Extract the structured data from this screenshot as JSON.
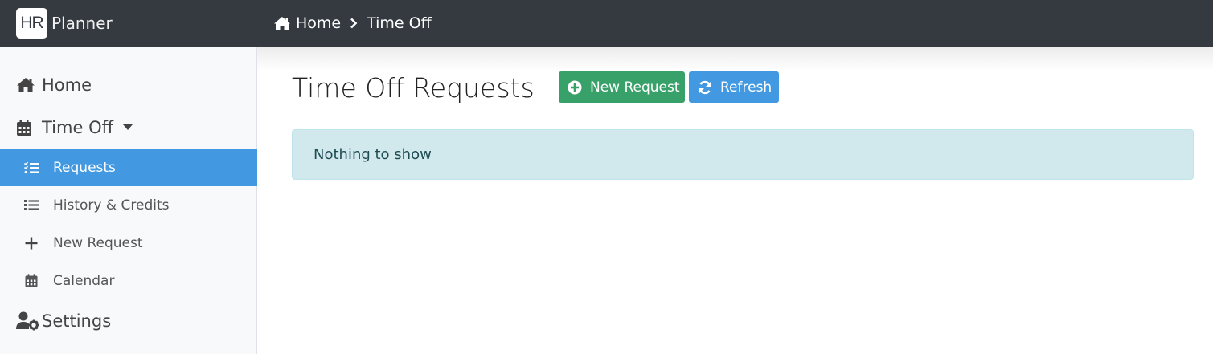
{
  "app": {
    "logo_mark": "HR",
    "logo_text": "Planner"
  },
  "breadcrumb": {
    "items": [
      {
        "label": "Home",
        "icon": "home-icon"
      },
      {
        "label": "Time Off"
      }
    ],
    "separator_icon": "chevron-right-icon"
  },
  "sidebar": {
    "home": {
      "label": "Home",
      "icon": "home-icon"
    },
    "time_off": {
      "label": "Time Off",
      "icon": "calendar-icon",
      "expanded": true
    },
    "sub_items": [
      {
        "label": "Requests",
        "icon": "tasks-icon",
        "active": true
      },
      {
        "label": "History & Credits",
        "icon": "list-icon",
        "active": false
      },
      {
        "label": "New Request",
        "icon": "plus-icon",
        "active": false
      },
      {
        "label": "Calendar",
        "icon": "calendar-icon",
        "active": false
      }
    ],
    "settings": {
      "label": "Settings",
      "icon": "user-cog-icon"
    }
  },
  "main": {
    "title": "Time Off Requests",
    "new_request_label": "New Request",
    "refresh_label": "Refresh",
    "empty_message": "Nothing to show"
  },
  "colors": {
    "topbar": "#343a40",
    "accent_blue": "#4299e1",
    "success_green": "#38a169",
    "info_bg": "#d1e9ed"
  }
}
